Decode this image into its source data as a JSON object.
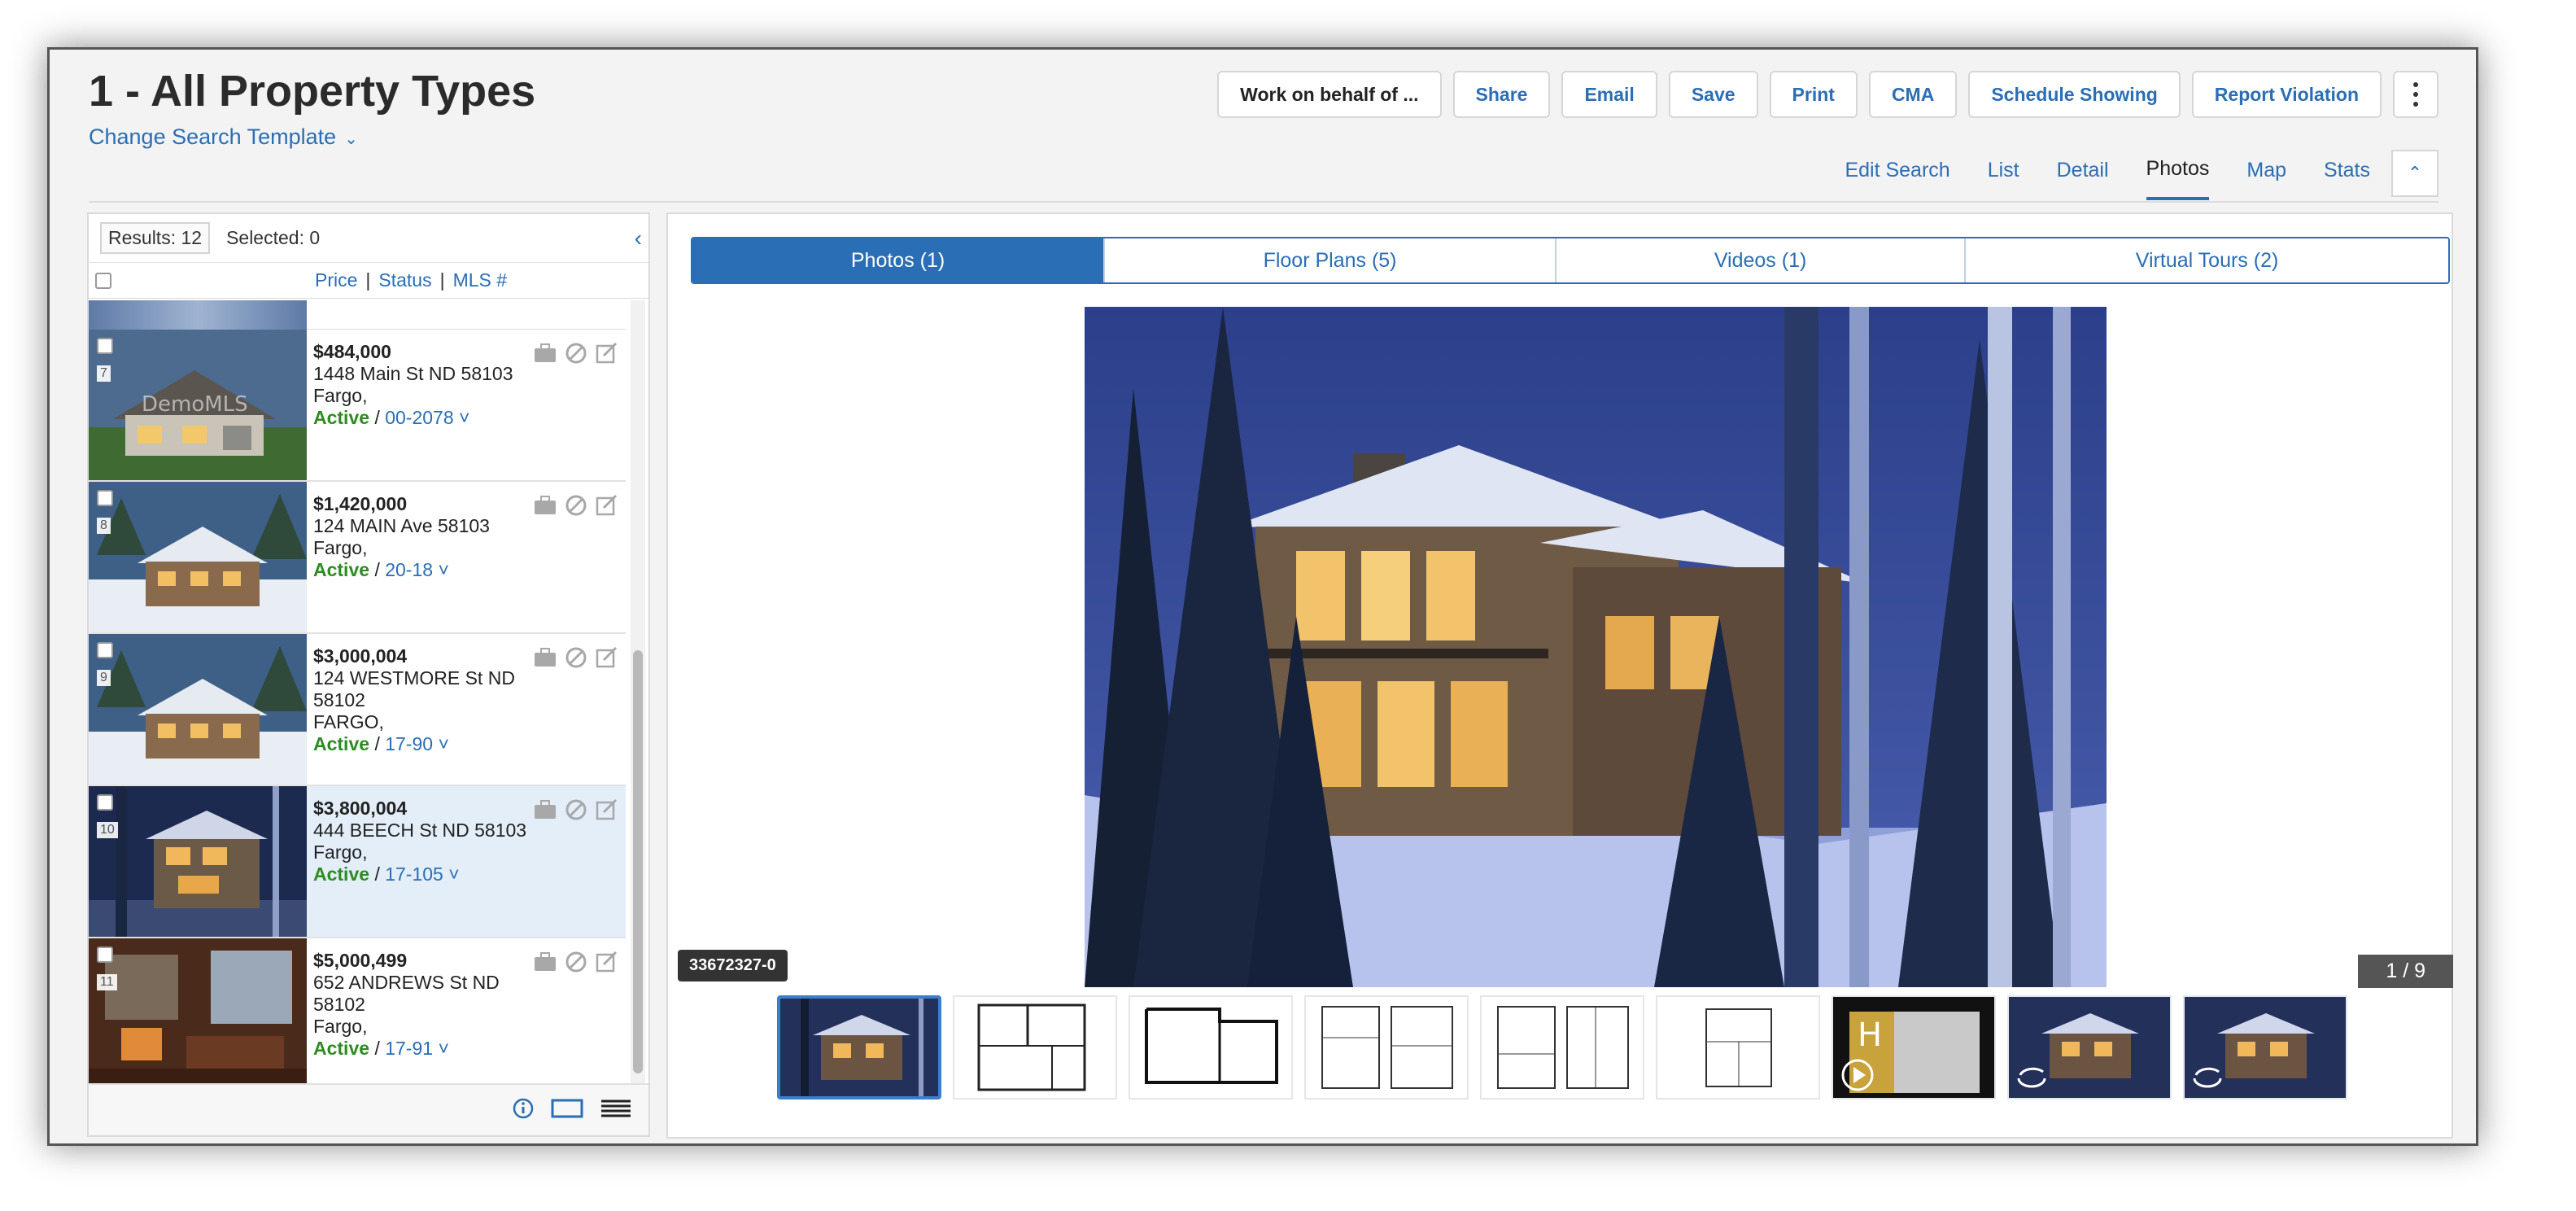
{
  "header": {
    "title": "1 - All Property Types",
    "change_template": "Change Search Template",
    "buttons": {
      "work_on_behalf": "Work on behalf of ...",
      "share": "Share",
      "email": "Email",
      "save": "Save",
      "print": "Print",
      "cma": "CMA",
      "schedule_showing": "Schedule Showing",
      "report_violation": "Report Violation"
    },
    "nav_tabs": [
      "Edit Search",
      "List",
      "Detail",
      "Photos",
      "Map",
      "Stats"
    ],
    "active_tab": "Photos"
  },
  "left_panel": {
    "results": "Results: 12",
    "selected": "Selected: 0",
    "sort_links": [
      "Price",
      "Status",
      "MLS #"
    ],
    "listings": [
      {
        "num": "7",
        "price": "$484,000",
        "address": "1448 Main St ND 58103",
        "city": "Fargo,",
        "status": "Active",
        "mls": "00-2078"
      },
      {
        "num": "8",
        "price": "$1,420,000",
        "address": "124 MAIN Ave 58103",
        "city": "Fargo,",
        "status": "Active",
        "mls": "20-18"
      },
      {
        "num": "9",
        "price": "$3,000,004",
        "address": "124 WESTMORE St ND 58102",
        "city": "FARGO,",
        "status": "Active",
        "mls": "17-90"
      },
      {
        "num": "10",
        "price": "$3,800,004",
        "address": "444 BEECH St ND 58103",
        "city": "Fargo,",
        "status": "Active",
        "mls": "17-105"
      },
      {
        "num": "11",
        "price": "$5,000,499",
        "address": "652 ANDREWS St ND 58102",
        "city": "Fargo,",
        "status": "Active",
        "mls": "17-91"
      }
    ],
    "watermark": "DemoMLS",
    "status_sep": "/"
  },
  "right_panel": {
    "media_tabs": [
      "Photos (1)",
      "Floor Plans (5)",
      "Videos (1)",
      "Virtual Tours (2)"
    ],
    "active_media_tab": "Photos (1)",
    "photo_id": "33672327-0",
    "photo_counter": "1 / 9",
    "thumbnail_count": 9
  },
  "colors": {
    "accent": "#2a6eb5",
    "active_status": "#2e8b22",
    "selected_row": "#e3eef9"
  }
}
